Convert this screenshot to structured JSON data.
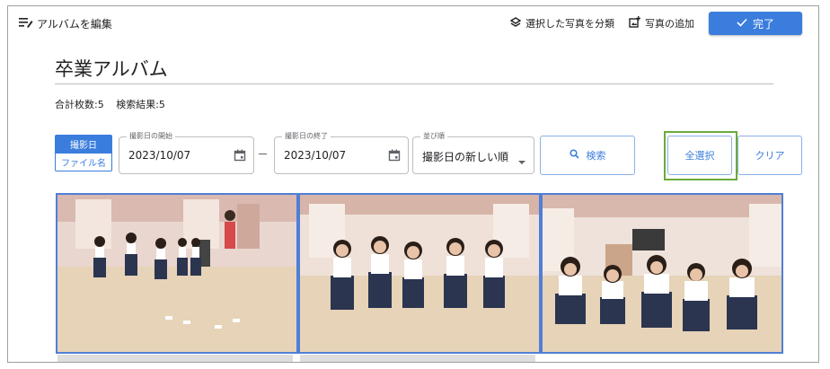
{
  "toolbar": {
    "edit_album_label": "アルバムを編集",
    "classify_label": "選択した写真を分類",
    "add_photo_label": "写真の追加",
    "done_label": "完了"
  },
  "album": {
    "title": "卒業アルバム",
    "total_count": "合計枚数:5",
    "search_result": "検索結果:5"
  },
  "filters": {
    "mode_options": [
      "撮影日",
      "ファイル名"
    ],
    "selected_mode": "撮影日",
    "start_date_label": "撮影日の開始",
    "start_date_value": "2023/10/07",
    "end_date_label": "撮影日の終了",
    "end_date_value": "2023/10/07",
    "sort_label": "並び順",
    "sort_value": "撮影日の新しい順",
    "search_button": "検索",
    "select_all_button": "全選択",
    "clear_button": "クリア"
  },
  "photos": [
    {
      "name": "photo-1"
    },
    {
      "name": "photo-2"
    },
    {
      "name": "photo-3"
    }
  ],
  "colors": {
    "accent": "#3b7ddd",
    "highlight": "#6aab3a",
    "photo_border": "#4f7fd6"
  },
  "icons": [
    "edit-list-icon",
    "classify-icon",
    "add-photo-icon",
    "check-icon",
    "calendar-icon",
    "dropdown-arrow-icon",
    "search-icon"
  ]
}
